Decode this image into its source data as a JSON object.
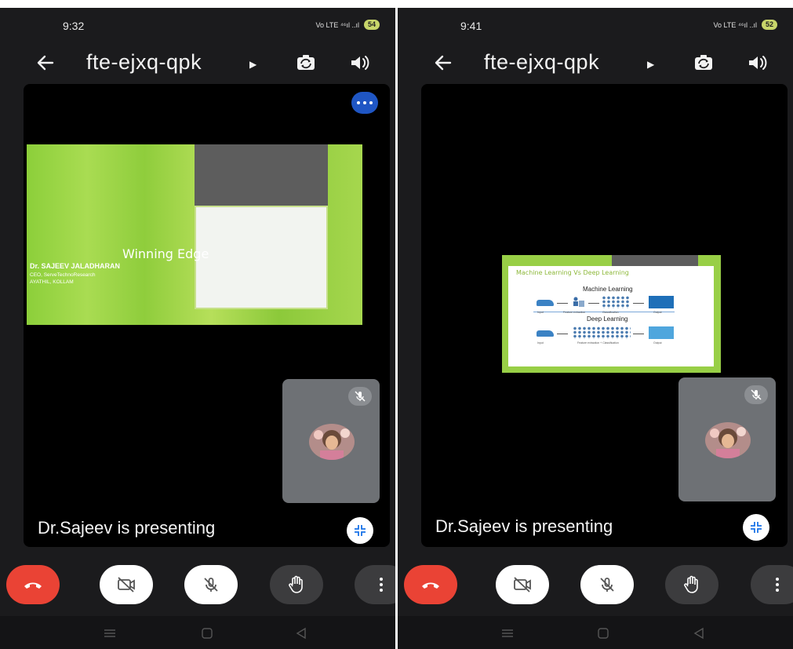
{
  "left": {
    "status": {
      "time": "9:32",
      "signal": "Vo LTE ⁴⁶ıl ..ıl",
      "battery": "54"
    },
    "meeting_code": "fte-ejxq-qpk",
    "slide": {
      "title": "Winning Edge",
      "name": "Dr. SAJEEV JALADHARAN",
      "line1": "CEO, ServeTechnoResearch",
      "line2": "AYATHIL, KOLLAM"
    },
    "presenting_text": "Dr.Sajeev is presenting"
  },
  "right": {
    "status": {
      "time": "9:41",
      "signal": "Vo LTE ⁴⁶ıl ..ıl",
      "battery": "52"
    },
    "meeting_code": "fte-ejxq-qpk",
    "slide": {
      "title": "Machine Learning Vs Deep Learning",
      "ml_label": "Machine Learning",
      "dl_label": "Deep Learning",
      "captions": {
        "input": "Input",
        "feature_extraction": "Feature extraction",
        "classification": "Classification",
        "output": "Output",
        "feature_extraction_classification": "Feature extraction + Classification"
      }
    },
    "presenting_text": "Dr.Sajeev is presenting"
  },
  "icons": {
    "back": "arrow-left-icon",
    "switch_camera": "switch-camera-icon",
    "speaker": "speaker-icon",
    "more": "more-options-icon",
    "mic_off": "mic-off-icon",
    "minimize": "minimize-icon",
    "end_call": "end-call-icon",
    "camera_off": "camera-off-icon",
    "raise_hand": "raise-hand-icon",
    "menu": "vertical-more-icon"
  },
  "colors": {
    "end_call": "#ea4335",
    "more_button": "#1f56c4",
    "slide_green": "#9bd24a",
    "background": "#1b1b1d"
  }
}
